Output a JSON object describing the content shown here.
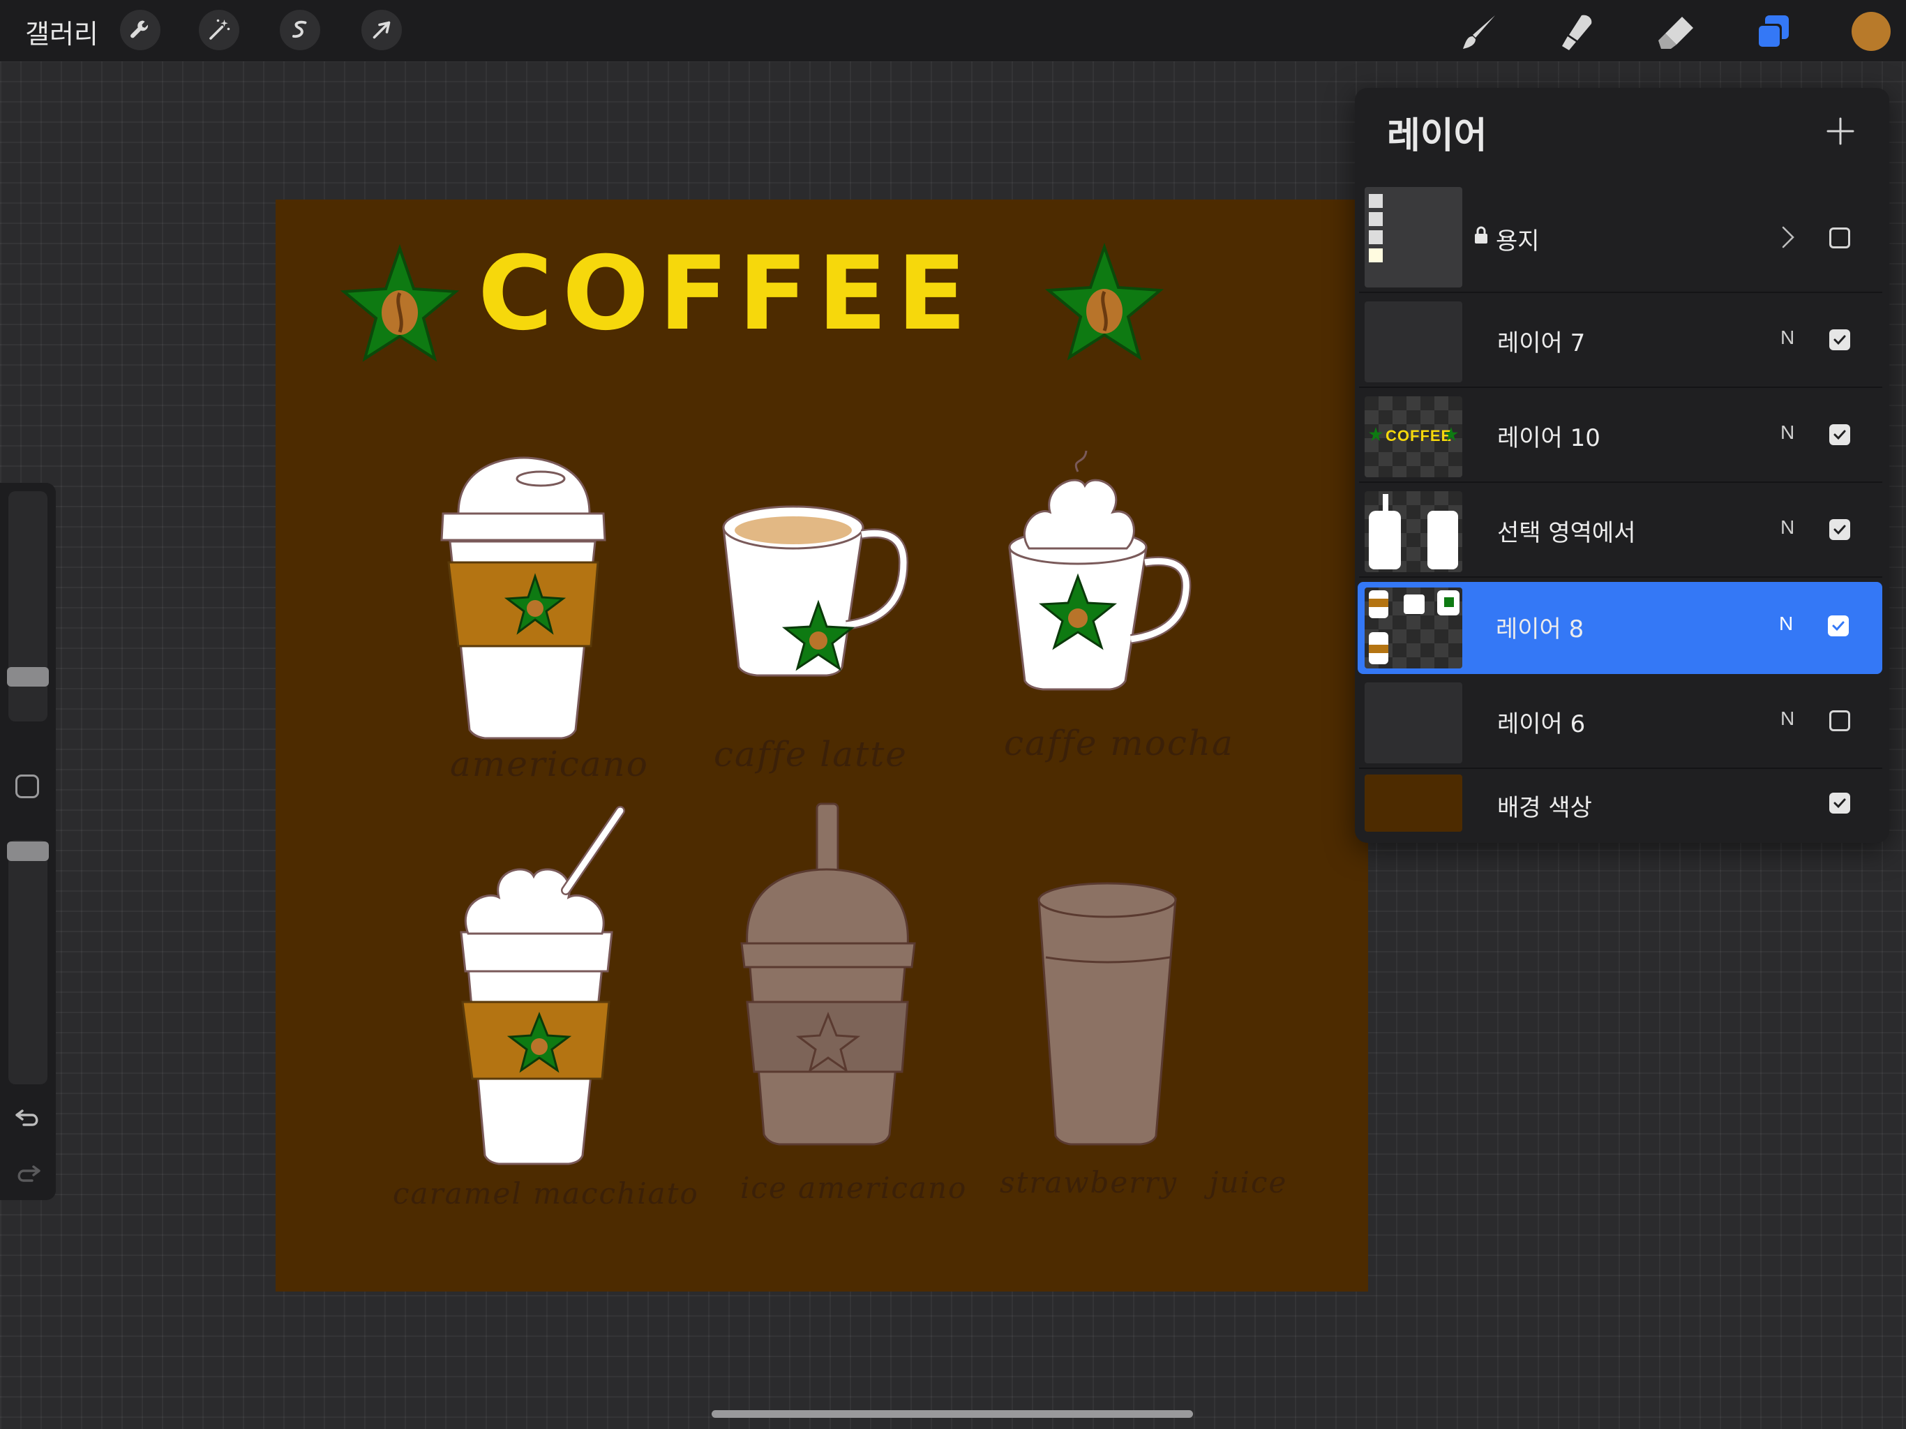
{
  "topbar": {
    "gallery_label": "갤러리",
    "left_tools": [
      "wrench-icon",
      "magic-wand-icon",
      "selection-icon",
      "transform-arrow-icon"
    ],
    "right_tools": [
      "brush-icon",
      "smudge-icon",
      "eraser-icon",
      "layers-icon"
    ],
    "current_color": "#b87a2a",
    "layers_icon_color": "#3478f6"
  },
  "sidebar": {
    "brush_size_level": 0.27,
    "opacity_level": 0.95,
    "icons": [
      "modifier-square-icon",
      "undo-icon",
      "redo-icon"
    ]
  },
  "canvas": {
    "background_color": "#4d2b00",
    "title": "COFFEE",
    "drinks": [
      {
        "label": "americano"
      },
      {
        "label": "caffe latte"
      },
      {
        "label": "caffe mocha"
      },
      {
        "label": "caramel macchiato"
      },
      {
        "label": "ice americano"
      },
      {
        "label": "strawberry juice"
      }
    ]
  },
  "layers_panel": {
    "title": "레이어",
    "add_icon": "plus-icon",
    "layers": [
      {
        "name": "용지",
        "blend": "",
        "visible": false,
        "locked": true,
        "group": true
      },
      {
        "name": "레이어 7",
        "blend": "N",
        "visible": true
      },
      {
        "name": "레이어 10",
        "blend": "N",
        "visible": true,
        "thumb_text": "COFFEE"
      },
      {
        "name": "선택 영역에서",
        "blend": "N",
        "visible": true
      },
      {
        "name": "레이어 8",
        "blend": "N",
        "visible": true,
        "selected": true
      },
      {
        "name": "레이어 6",
        "blend": "N",
        "visible": false
      },
      {
        "name": "배경 색상",
        "blend": "",
        "visible": true
      }
    ]
  }
}
